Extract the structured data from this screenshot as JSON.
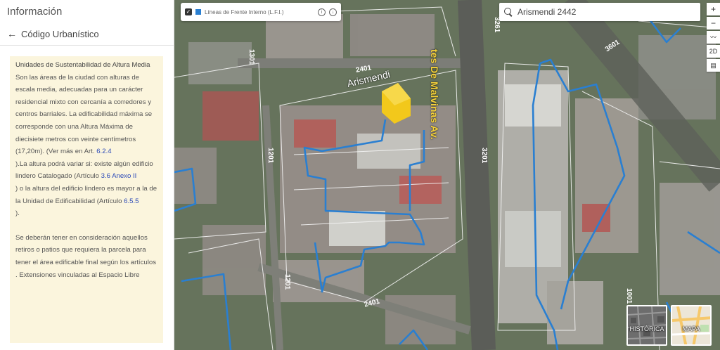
{
  "panel": {
    "title": "Información",
    "back_label": "Código Urbanístico",
    "content": {
      "heading": "Unidades de Sustentabilidad de Altura Media",
      "para1": "Son las áreas de la ciudad con alturas de escala media, adecuadas para un carácter residencial mixto con cercanía a corredores y centros barriales. La edificabilidad máxima se corresponde con una Altura Máxima de diecisiete metros con veinte centímetros (17,20m). (Ver más en Art.",
      "link1": "6.2.4",
      "para2": ").La altura podrá variar si: existe algún edificio lindero Catalogado (Artículo",
      "link2": "3.6 Anexo II",
      "para3": ") o la altura del edificio lindero es mayor a la de la Unidad de Edificabilidad (Artículo",
      "link3": "6.5.5",
      "para4": ").",
      "para5": "Se deberán tener en consideración aquellos retiros o patios que requiera la parcela para tener el área edificable final según los artículos",
      "para6": ". Extensiones vinculadas al Espacio Libre"
    }
  },
  "layer": {
    "label": "Líneas de Frente Interno (L.F.I.)",
    "info_icon": "info-icon",
    "download_icon": "download-icon"
  },
  "search": {
    "value": "Arismendi 2442"
  },
  "toolbar": {
    "zoom_in": "+",
    "zoom_out": "−",
    "chart": "〰",
    "mode": "2D",
    "measure": "▤"
  },
  "map_labels": {
    "street1": "Arismendi",
    "street2": "tes De Malvinas Av.",
    "n2401a": "2401",
    "n2401b": "2401",
    "n1301": "1301",
    "n1201a": "1201",
    "n1201b": "1201",
    "n3201a": "3201",
    "n3201b": "3261",
    "n3601": "3601",
    "n1001": "1001"
  },
  "basemaps": {
    "historic": "HISTÓRICA",
    "map": "MAPA"
  },
  "colors": {
    "accent_blue": "#2a7fd1",
    "panel_bg": "#fbf5dd",
    "link": "#2a49b8",
    "highlight": "#f2c81b"
  }
}
